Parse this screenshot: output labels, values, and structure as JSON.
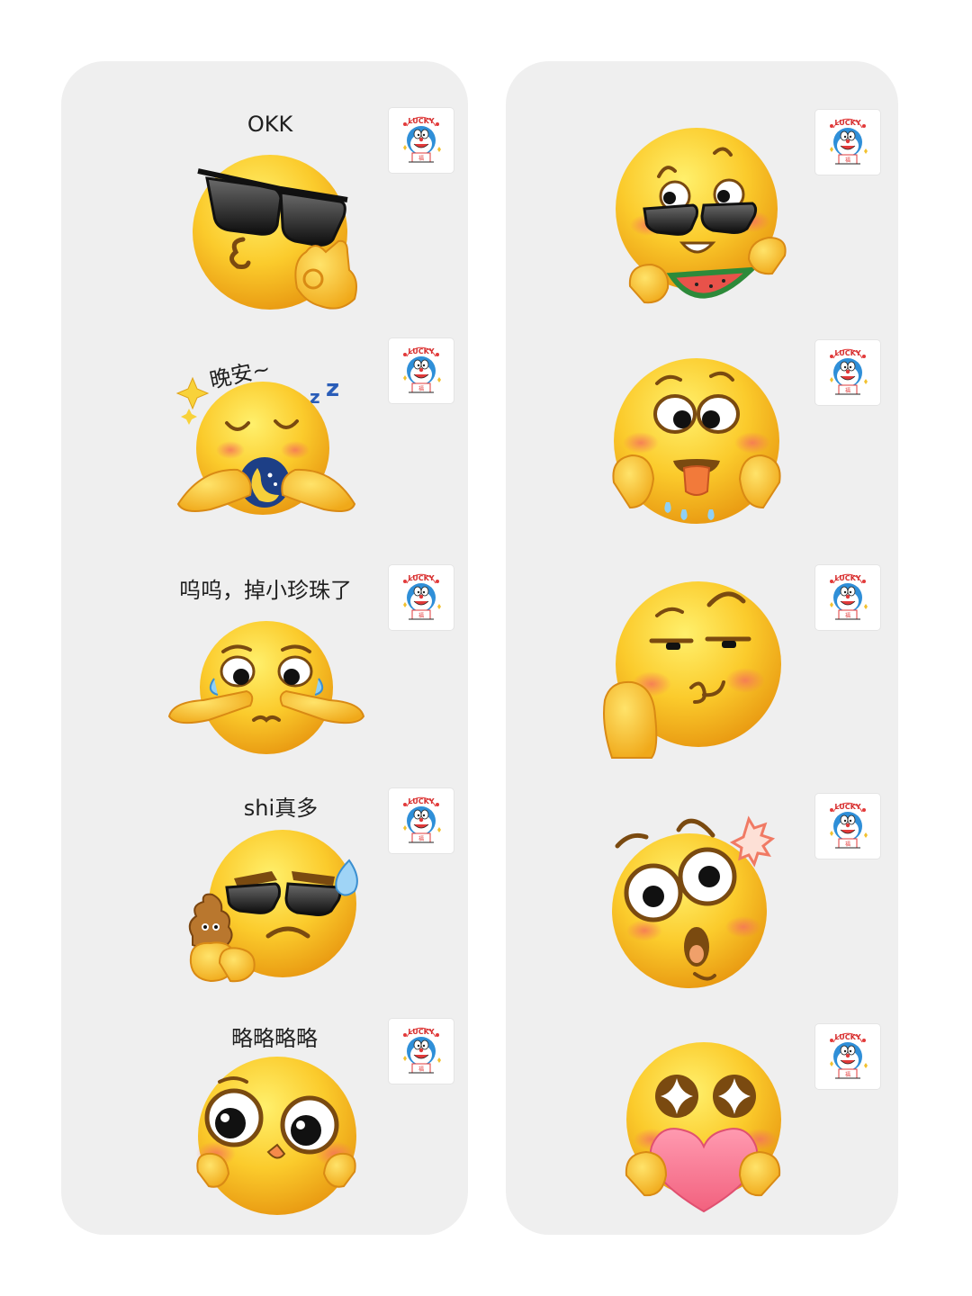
{
  "left_column": {
    "items": [
      {
        "caption": "OKK",
        "icon": "cool-sunglasses-ok-hand-emoji"
      },
      {
        "caption": "晚安~",
        "icon": "sleeping-emoji-with-moon"
      },
      {
        "caption": "呜呜，掉小珍珠了",
        "icon": "crying-emoji"
      },
      {
        "caption": "shi真多",
        "icon": "sunglasses-poop-sweat-emoji"
      },
      {
        "caption": "略略略略",
        "icon": "big-eyes-cute-emoji"
      }
    ]
  },
  "right_column": {
    "items": [
      {
        "caption": "",
        "icon": "sunglasses-watermelon-emoji"
      },
      {
        "caption": "",
        "icon": "drooling-tongue-emoji"
      },
      {
        "caption": "",
        "icon": "smirk-hand-emoji"
      },
      {
        "caption": "",
        "icon": "surprised-emoji"
      },
      {
        "caption": "",
        "icon": "starry-eyes-heart-emoji"
      }
    ]
  },
  "watermark": {
    "text": "LUCKY",
    "icon": "doraemon-lucky-badge-icon"
  },
  "colors": {
    "panel": "#efefef",
    "face": "#fbc22a",
    "face_light": "#fde466",
    "face_dark": "#e79a10",
    "blush": "#f6866a"
  }
}
